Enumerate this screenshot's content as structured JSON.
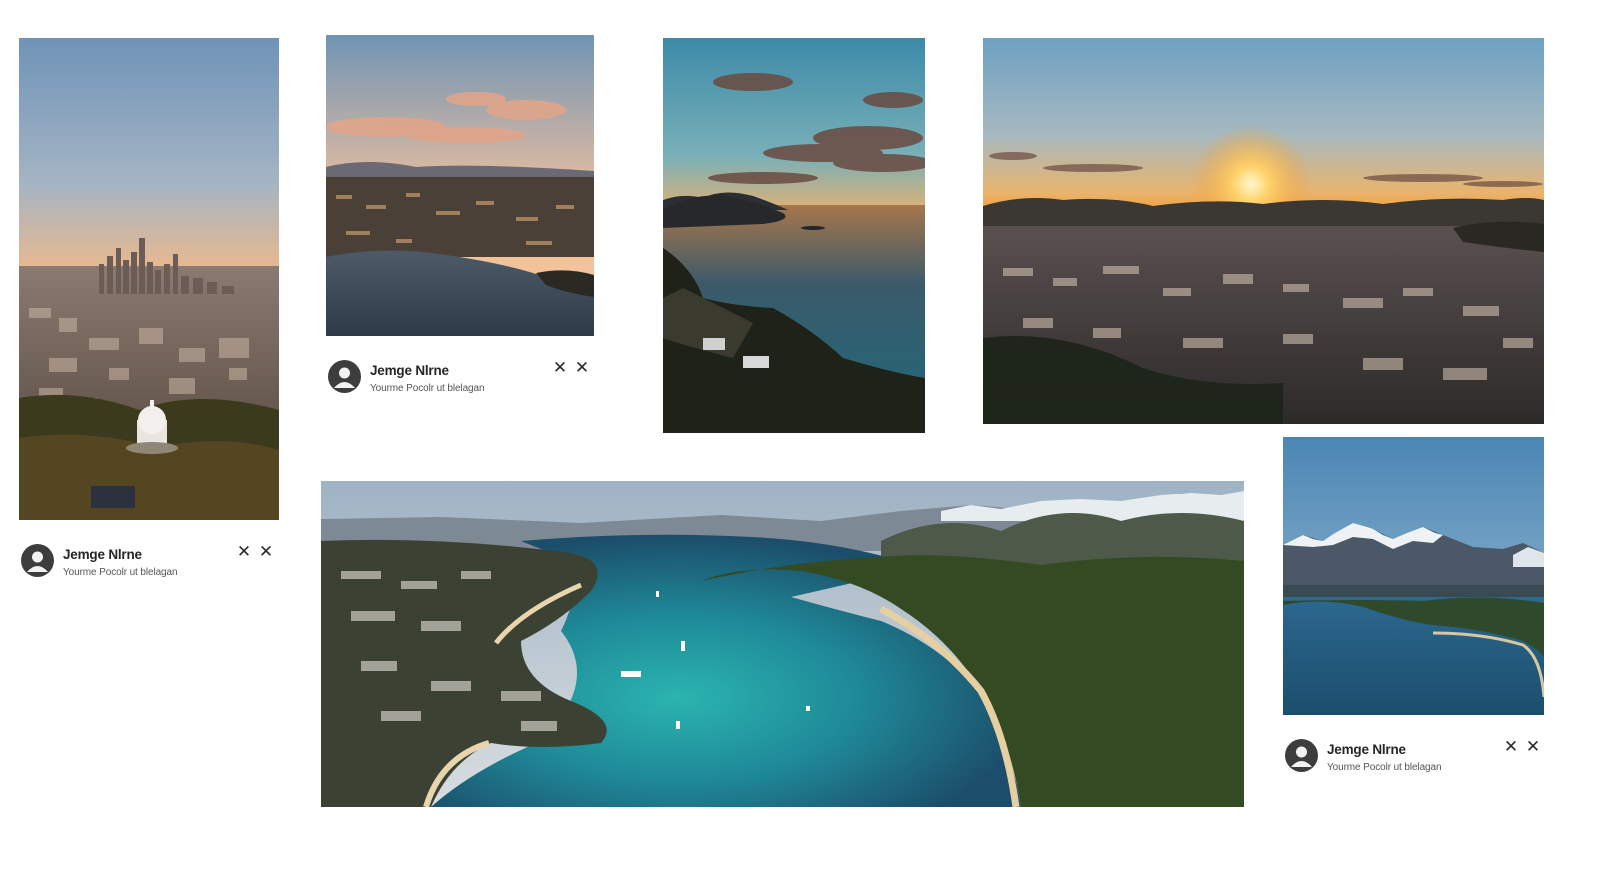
{
  "cards": [
    {
      "id": "city-skyline",
      "image_subject": "city-skyline-sunset",
      "author": "Jemge Nlrne",
      "subtitle": "Yourme Pocolr ut blelagan",
      "close_glyph": "✕",
      "close2_glyph": "✕"
    },
    {
      "id": "harbor-city",
      "image_subject": "harbor-city-sunset",
      "author": "Jemge Nlrne",
      "subtitle": "Yourme Pocolr ut blelagan",
      "close_glyph": "✕",
      "close2_glyph": "✕"
    },
    {
      "id": "coastal-cliff",
      "image_subject": "coastal-cliff-ocean"
    },
    {
      "id": "city-sunrise",
      "image_subject": "aerial-city-sunrise"
    },
    {
      "id": "bay-panorama",
      "image_subject": "turquoise-bay-forest"
    },
    {
      "id": "mountain-lake",
      "image_subject": "snowy-mountain-lake",
      "author": "Jemge Nlrne",
      "subtitle": "Yourme Pocolr ut blelagan",
      "close_glyph": "✕",
      "close2_glyph": "✕"
    }
  ],
  "colors": {
    "background": "#ffffff",
    "text_primary": "#262626",
    "text_secondary": "#555555",
    "avatar": "#3d3d3d"
  },
  "icons": {
    "avatar": "user-avatar-icon",
    "close": "close-icon"
  }
}
